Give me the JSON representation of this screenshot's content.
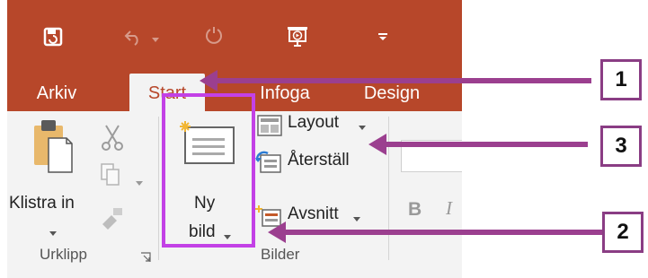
{
  "tabs": [
    {
      "label": "Arkiv",
      "active": false
    },
    {
      "label": "Start",
      "active": true
    },
    {
      "label": "Infoga",
      "active": false
    },
    {
      "label": "Design",
      "active": false
    }
  ],
  "clipboard": {
    "paste_label": "Klistra in",
    "group_label": "Urklipp"
  },
  "slides": {
    "new_slide_line1": "Ny",
    "new_slide_line2": "bild",
    "layout_label": "Layout",
    "reset_label": "Återställ",
    "section_label": "Avsnitt",
    "group_label": "Bilder"
  },
  "font": {
    "bold": "B",
    "italic": "I"
  },
  "callouts": {
    "c1": "1",
    "c2": "2",
    "c3": "3"
  },
  "colors": {
    "title_bar": "#b7472a",
    "highlight_box": "#c341e6",
    "arrow": "#9b3f8f"
  }
}
